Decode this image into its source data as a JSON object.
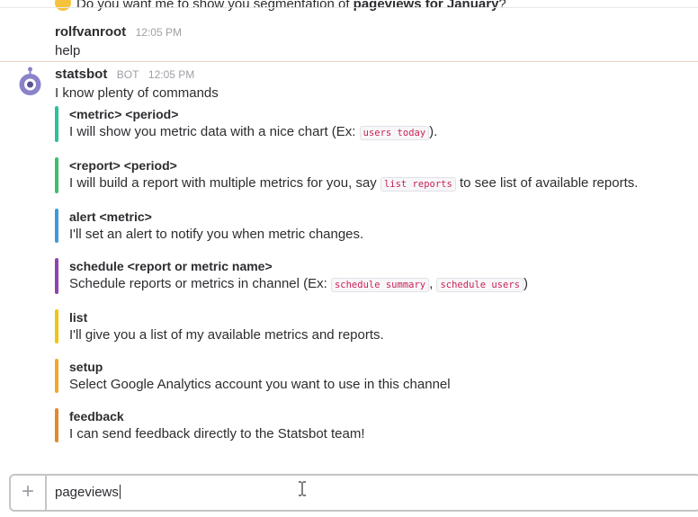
{
  "top_message": {
    "text_before": "Do you want me to show you segmentation of ",
    "bold": "pageviews for January",
    "text_after": "?"
  },
  "user_message": {
    "sender": "rolfvanroot",
    "time": "12:05 PM",
    "text": "help"
  },
  "bot_message": {
    "sender": "statsbot",
    "tag": "BOT",
    "time": "12:05 PM",
    "text": "I know plenty of commands",
    "attachments": [
      {
        "title": "<metric> <period>",
        "desc_before": "I will show you metric data with a nice chart (Ex: ",
        "code1": "users today",
        "desc_after": ").",
        "color": "#2fbf9a"
      },
      {
        "title": "<report> <period>",
        "desc_before": "I will build a report with multiple metrics for you, say ",
        "code1": "list reports",
        "desc_after": " to see list of available reports.",
        "color": "#3ac06b"
      },
      {
        "title": "alert <metric>",
        "desc_before": "I'll set an alert to notify you when metric changes.",
        "color": "#3d9ad6"
      },
      {
        "title": "schedule <report or metric name>",
        "desc_before": "Schedule reports or metrics in channel (Ex: ",
        "code1": "schedule summary",
        "sep": ", ",
        "code2": "schedule users",
        "desc_after": ")",
        "color": "#8e44ad"
      },
      {
        "title": "list",
        "desc_before": "I'll give you a list of my available metrics and reports.",
        "color": "#f1c40f"
      },
      {
        "title": "setup",
        "desc_before": "Select Google Analytics account you want to use in this channel",
        "color": "#f0a92a"
      },
      {
        "title": "feedback",
        "desc_before": "I can send feedback directly to the Statsbot team!",
        "color": "#e08a2b"
      }
    ]
  },
  "composer": {
    "plus": "+",
    "value": "pageviews"
  }
}
